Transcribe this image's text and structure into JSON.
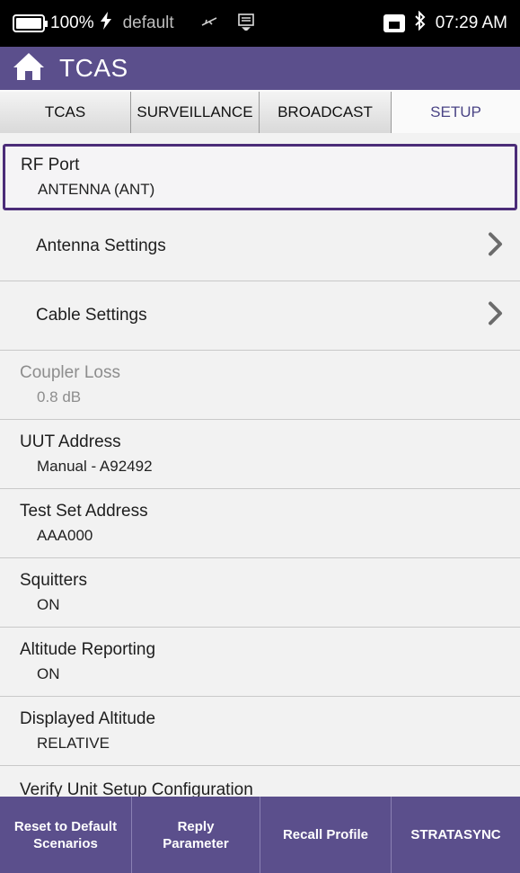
{
  "status_bar": {
    "battery": "100%",
    "charging_icon": "lightning-icon",
    "profile": "default",
    "time": "07:29 AM",
    "icons": [
      "battery-icon",
      "lightning-icon",
      "usb-icon",
      "notification-icon",
      "ethernet-icon",
      "bluetooth-icon"
    ]
  },
  "header": {
    "title": "TCAS",
    "home_icon": "home-icon"
  },
  "tabs": [
    {
      "label": "TCAS"
    },
    {
      "label": "SURVEILLANCE"
    },
    {
      "label": "BROADCAST"
    },
    {
      "label": "SETUP",
      "active": true
    }
  ],
  "settings": {
    "rf_port": {
      "label": "RF Port",
      "value": "ANTENNA (ANT)"
    },
    "antenna_settings": {
      "label": "Antenna Settings"
    },
    "cable_settings": {
      "label": "Cable Settings"
    },
    "coupler_loss": {
      "label": "Coupler Loss",
      "value": "0.8 dB"
    },
    "uut_address": {
      "label": "UUT Address",
      "value": "Manual - A92492"
    },
    "test_set_address": {
      "label": "Test Set Address",
      "value": "AAA000"
    },
    "squitters": {
      "label": "Squitters",
      "value": "ON"
    },
    "altitude_reporting": {
      "label": "Altitude Reporting",
      "value": "ON"
    },
    "displayed_altitude": {
      "label": "Displayed Altitude",
      "value": "RELATIVE"
    },
    "verify_unit": {
      "label": "Verify Unit Setup Configuration"
    }
  },
  "actions": {
    "reset": "Reset to Default\nScenarios",
    "reply": "Reply\nParameter",
    "recall": "Recall Profile",
    "stratasync": "STRATASYNC"
  },
  "colors": {
    "brand": "#5b4f8c",
    "active_tab_text": "#4a4485",
    "selection_border": "#4b2c78"
  }
}
